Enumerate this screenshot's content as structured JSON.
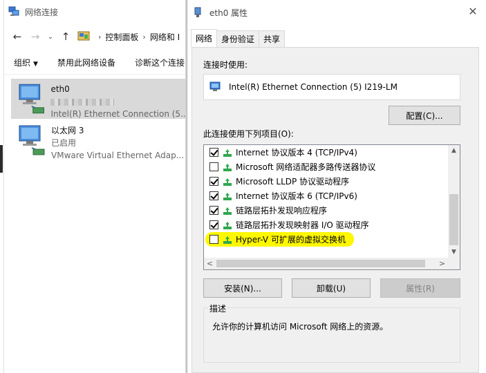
{
  "background_window": {
    "title": "网络连接",
    "nav": {
      "back": "←",
      "forward": "→",
      "dropdown": "⌄",
      "up": "↑"
    },
    "breadcrumb": [
      "控制面板",
      "网络和 I"
    ],
    "toolbar": {
      "organize": "组织",
      "disable": "禁用此网络设备",
      "diagnose": "诊断这个连接"
    },
    "adapters": [
      {
        "name": "eth0",
        "status": "",
        "desc": "Intel(R) Ethernet Connection (5..."
      },
      {
        "name": "以太网 3",
        "status": "已启用",
        "desc": "VMware Virtual Ethernet Adap..."
      }
    ]
  },
  "dialog": {
    "title": "eth0 属性",
    "close": "✕",
    "tabs": [
      "网络",
      "身份验证",
      "共享"
    ],
    "connect_using_label": "连接时使用:",
    "adapter_name": "Intel(R) Ethernet Connection (5) I219-LM",
    "configure_button": "配置(C)...",
    "items_label": "此连接使用下列项目(O):",
    "items": [
      {
        "label": "Internet 协议版本 4 (TCP/IPv4)",
        "checked": true
      },
      {
        "label": "Microsoft 网络适配器多路传送器协议",
        "checked": false
      },
      {
        "label": "Microsoft LLDP 协议驱动程序",
        "checked": true
      },
      {
        "label": "Internet 协议版本 6 (TCP/IPv6)",
        "checked": true
      },
      {
        "label": "链路层拓扑发现响应程序",
        "checked": true
      },
      {
        "label": "链路层拓扑发现映射器 I/O 驱动程序",
        "checked": true
      },
      {
        "label": "Hyper-V 可扩展的虚拟交换机",
        "checked": false,
        "highlighted": true
      }
    ],
    "scroll": {
      "up": "▲",
      "down": "▼",
      "left": "<",
      "right": ">"
    },
    "install_button": "安装(N)...",
    "uninstall_button": "卸载(U)",
    "properties_button": "属性(R)",
    "description_legend": "描述",
    "description_text": "允许你的计算机访问 Microsoft 网络上的资源。"
  },
  "colors": {
    "highlight": "#fff700",
    "selected_row": "#d9d9d9",
    "panel_bg": "#f0f0f0",
    "component_icon": "#2fa84f"
  }
}
